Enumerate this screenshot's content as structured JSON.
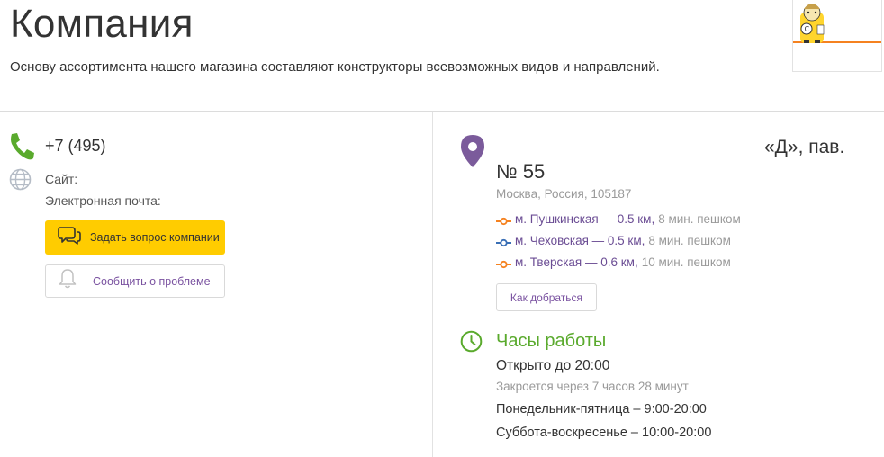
{
  "header": {
    "title": "Компания",
    "description": "Основу ассортимента нашего магазина составляют конструкторы всевозможных видов и направлений."
  },
  "contacts": {
    "phone": "+7 (495)",
    "site_label": "Сайт:",
    "email_label": "Электронная почта:",
    "ask_button": "Задать вопрос компании",
    "report_button": "Сообщить о проблеме"
  },
  "address": {
    "line1": "«Д», пав.",
    "line2": "№ 55",
    "city": "Москва, Россия, 105187",
    "metro": [
      {
        "name": "м. Пушкинская — 0.5 км,",
        "walk": "8 мин. пешком",
        "color": "#f58220"
      },
      {
        "name": "м. Чеховская — 0.5 км,",
        "walk": "8 мин. пешком",
        "color": "#3a6fb5"
      },
      {
        "name": "м. Тверская — 0.6 км,",
        "walk": "10 мин. пешком",
        "color": "#f58220"
      }
    ],
    "route_button": "Как добраться"
  },
  "hours": {
    "title": "Часы работы",
    "open_until": "Открыто до 20:00",
    "closes_in": "Закроется через 7 часов 28 минут",
    "weekdays": "Понедельник-пятница – 9:00-20:00",
    "weekend": "Суббота-воскресенье – 10:00-20:00"
  },
  "colors": {
    "accent_yellow": "#ffcc00",
    "accent_green": "#5aaa2d",
    "accent_purple": "#7a52a0",
    "pin_purple": "#7b5b9b"
  },
  "icons": [
    "phone-icon",
    "globe-icon",
    "chat-icon",
    "bell-icon",
    "map-pin-icon",
    "clock-icon",
    "metro-line-icon"
  ]
}
